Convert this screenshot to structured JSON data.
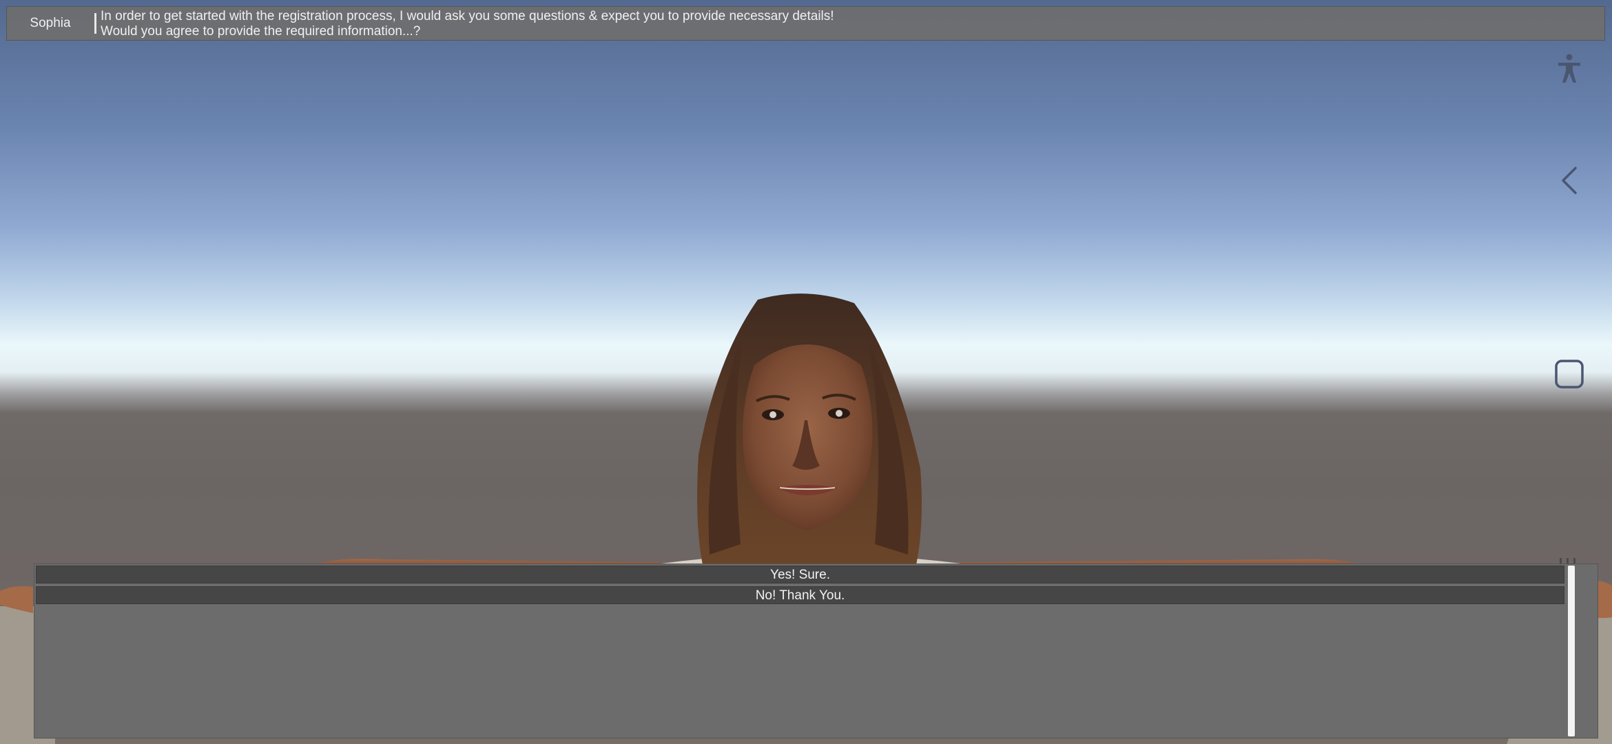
{
  "dialog": {
    "speaker": "Sophia",
    "line1": "In order to get started with the registration process, I would ask you some questions & expect you to provide necessary details!",
    "line2": "Would you agree to provide the required information...?"
  },
  "side_nav": {
    "icons": [
      "accessibility-icon",
      "back-chevron-icon",
      "home-square-icon"
    ]
  },
  "choices": {
    "options": [
      "Yes! Sure.",
      "No! Thank You."
    ]
  },
  "colors": {
    "panel": "#6c6c6c",
    "choice_button": "#464646",
    "text": "#f0f0f0",
    "icon": "#4a5670"
  }
}
